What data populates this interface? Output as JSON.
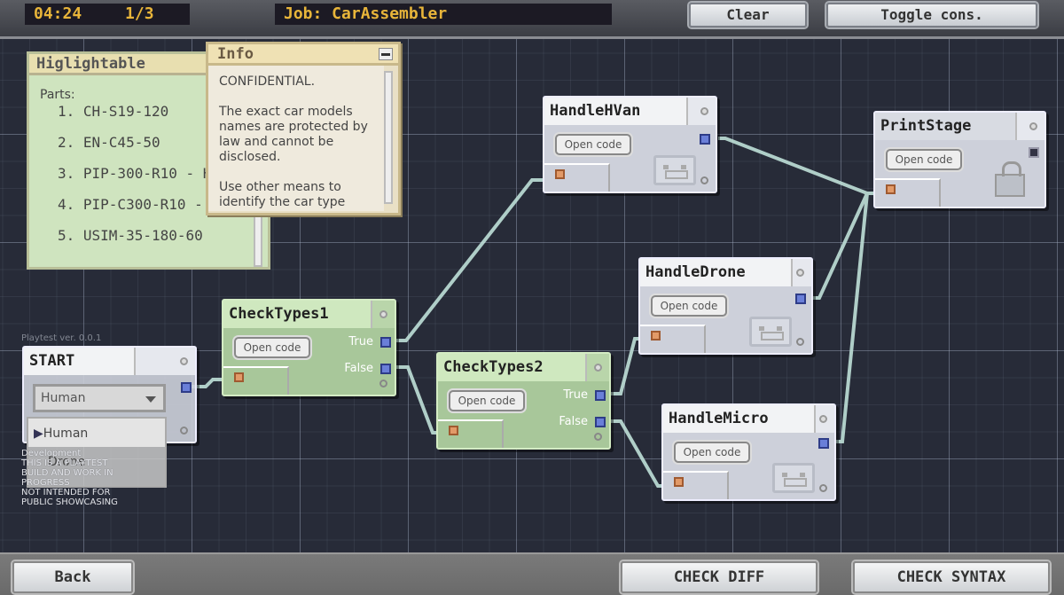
{
  "topbar": {
    "timer": "04:24",
    "progress": "1/3",
    "job": "Job: CarAssembler",
    "clear": "Clear",
    "toggle": "Toggle cons."
  },
  "highlightable": {
    "title": "Higlightable",
    "parts_label": "Parts:",
    "parts": [
      "1. CH-S19-120",
      "2. EN-C45-50",
      "3. PIP-300-R10 - H",
      "4. PIP-C300-R10 -",
      "5. USIM-35-180-60"
    ]
  },
  "info": {
    "title": "Info",
    "paragraphs": [
      "CONFIDENTIAL.",
      "The exact car models names are protected by law and  cannot be disclosed.",
      "Use other means to identify the car type"
    ]
  },
  "watermark": {
    "version": "Playtest ver. 0.0.1",
    "lines": [
      "Development",
      "THIS IS A PLAYTEST",
      "BUILD AND WORK IN",
      "PROGRESS",
      "NOT INTENDED FOR",
      "PUBLIC SHOWCASING"
    ]
  },
  "nodes": {
    "start": {
      "name": "START",
      "selected": "Human",
      "options": [
        "Human",
        "Drone"
      ]
    },
    "check1": {
      "name": "CheckTypes1",
      "open": "Open code",
      "true": "True",
      "false": "False"
    },
    "check2": {
      "name": "CheckTypes2",
      "open": "Open code",
      "true": "True",
      "false": "False"
    },
    "hvan": {
      "name": "HandleHVan",
      "open": "Open code"
    },
    "drone": {
      "name": "HandleDrone",
      "open": "Open code"
    },
    "micro": {
      "name": "HandleMicro",
      "open": "Open code"
    },
    "print": {
      "name": "PrintStage",
      "open": "Open code"
    }
  },
  "bottombar": {
    "back": "Back",
    "check_diff": "CHECK DIFF",
    "check_syntax": "CHECK SYNTAX"
  },
  "colors": {
    "wire": "#bfe0d8",
    "lcd_text": "#e8b53a",
    "node_green": "#a8c79a",
    "node_gray": "#cdd0da",
    "output_port": "#6a7fd8",
    "input_port": "#e29a68"
  }
}
